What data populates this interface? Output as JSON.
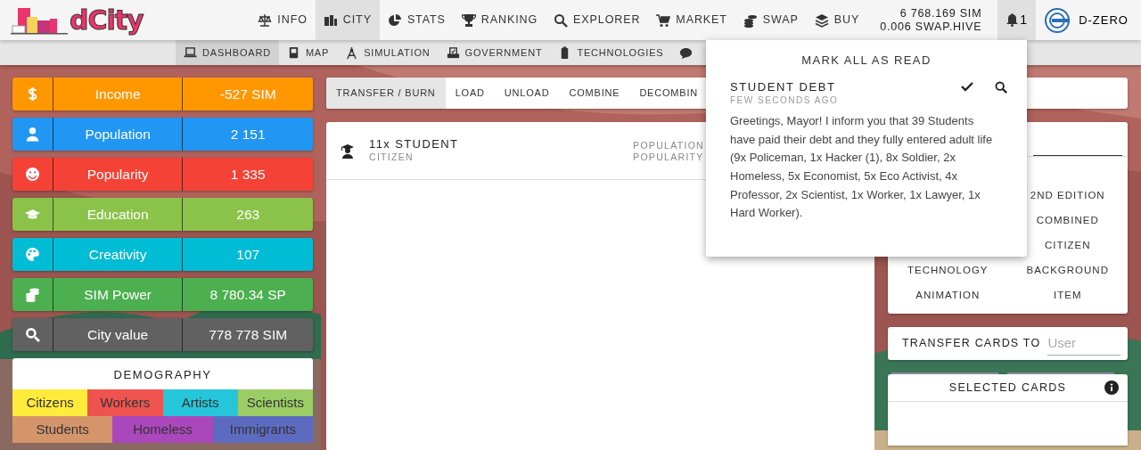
{
  "logo": {
    "text": "dCity"
  },
  "nav": [
    {
      "label": "INFO",
      "selected": false
    },
    {
      "label": "CITY",
      "selected": true
    },
    {
      "label": "STATS",
      "selected": false
    },
    {
      "label": "RANKING",
      "selected": false
    },
    {
      "label": "EXPLORER",
      "selected": false
    },
    {
      "label": "MARKET",
      "selected": false
    },
    {
      "label": "SWAP",
      "selected": false
    },
    {
      "label": "BUY",
      "selected": false
    }
  ],
  "balance": [
    "6 768.169 SIM",
    "0.006 SWAP.HIVE"
  ],
  "notifications": {
    "count": "1",
    "open": true
  },
  "user": {
    "name": "D-ZERO"
  },
  "subnav": [
    {
      "label": "DASHBOARD",
      "selected": true
    },
    {
      "label": "MAP",
      "selected": false
    },
    {
      "label": "SIMULATION",
      "selected": false
    },
    {
      "label": "GOVERNMENT",
      "selected": false
    },
    {
      "label": "TECHNOLOGIES",
      "selected": false
    },
    {
      "selected": false
    }
  ],
  "stats": [
    {
      "label": "Income",
      "value": "-527 SIM",
      "color": "#ff9800"
    },
    {
      "label": "Population",
      "value": "2 151",
      "color": "#2196f3"
    },
    {
      "label": "Popularity",
      "value": "1 335",
      "color": "#f44336"
    },
    {
      "label": "Education",
      "value": "263",
      "color": "#8bc34a"
    },
    {
      "label": "Creativity",
      "value": "107",
      "color": "#00bcd4"
    },
    {
      "label": "SIM Power",
      "value": "8 780.34 SP",
      "color": "#4caf50"
    },
    {
      "label": "City value",
      "value": "778 778 SIM",
      "color": "#616161"
    }
  ],
  "demography": {
    "title": "DEMOGRAPHY",
    "rows": [
      {
        "groups": [
          {
            "label": "Citizens",
            "color": "#ffeb3b"
          },
          {
            "label": "Workers",
            "color": "#ef5350"
          },
          {
            "label": "Artists",
            "color": "#26c6da"
          },
          {
            "label": "Scientists",
            "color": "#9ccc65"
          }
        ]
      },
      {
        "groups": [
          {
            "label": "Students",
            "color": "#d4956a"
          },
          {
            "label": "Homeless",
            "color": "#ab47bc"
          },
          {
            "label": "Immigrants",
            "color": "#5c6bc0"
          }
        ]
      }
    ]
  },
  "card_tabs": [
    {
      "label": "TRANSFER / BURN",
      "selected": true
    },
    {
      "label": "LOAD",
      "selected": false
    },
    {
      "label": "UNLOAD",
      "selected": false
    },
    {
      "label": "COMBINE",
      "selected": false
    },
    {
      "label": "DECOMBIN",
      "selected": false
    }
  ],
  "cards": [
    {
      "name": "11x STUDENT",
      "type": "CITIZEN",
      "attributes": [
        "POPULATION",
        "POPULARITY"
      ]
    }
  ],
  "filters": {
    "rows": [
      {
        "right": "2ND EDITION"
      },
      {
        "right": "COMBINED"
      },
      {
        "right": "CITIZEN"
      },
      {
        "left": "TECHNOLOGY",
        "right": "BACKGROUND"
      },
      {
        "left": "ANIMATION",
        "right": "ITEM"
      }
    ]
  },
  "transfer": {
    "label": "TRANSFER CARDS TO",
    "placeholder": "User"
  },
  "selected_cards": {
    "title": "SELECTED CARDS"
  },
  "popup": {
    "action": "MARK ALL AS READ",
    "items": [
      {
        "title": "STUDENT DEBT",
        "time": "FEW SECONDS AGO",
        "message": "Greetings, Mayor! I inform you that 39 Students have paid their debt and they fully entered adult life (9x Policeman, 1x Hacker (1), 8x Soldier, 2x Homeless, 5x Economist, 5x Eco Activist, 4x Professor, 2x Scientist, 1x Worker, 1x Lawyer, 1x Hard Worker)."
      }
    ]
  }
}
